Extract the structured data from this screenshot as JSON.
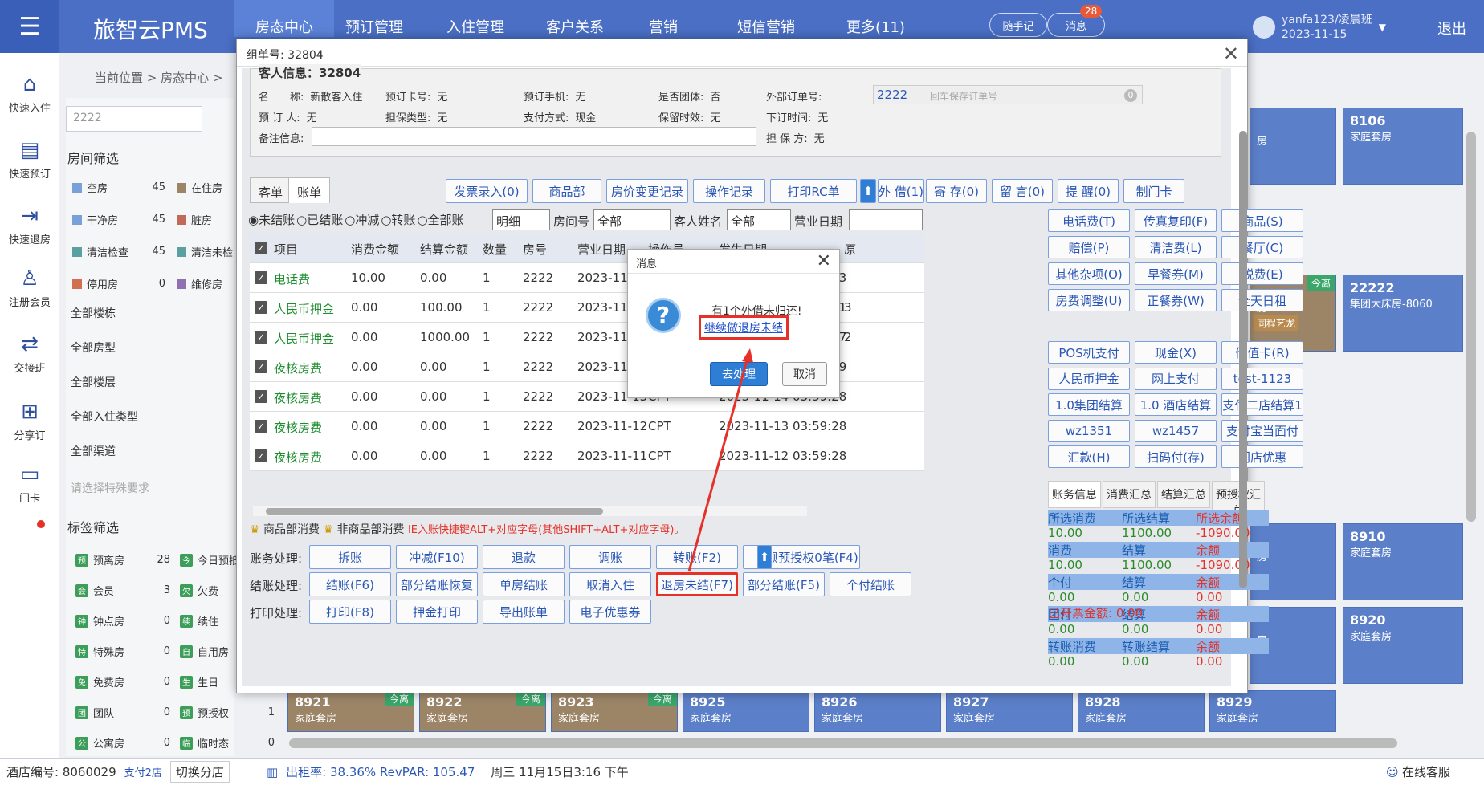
{
  "app": {
    "logo": "旅智云PMS",
    "logout": "退出"
  },
  "nav": [
    "房态中心",
    "预订管理",
    "入住管理",
    "客户关系",
    "营销",
    "短信营销",
    "更多(11)"
  ],
  "topActions": {
    "note": "随手记",
    "message": "消息",
    "messageCount": "28"
  },
  "user": {
    "name": "yanfa123/凌晨班",
    "date": "2023-11-15"
  },
  "leftNav": [
    "快速入住",
    "快速预订",
    "快速退房",
    "注册会员",
    "交接班",
    "分享订",
    "门卡"
  ],
  "breadcrumb": "当前位置 > 房态中心 >",
  "filter": {
    "searchValue": "2222",
    "title": "房间筛选",
    "status": [
      {
        "label": "空房",
        "count": "45",
        "color": "#7aa0d8"
      },
      {
        "label": "在住房",
        "count": "",
        "color": "#9c8567"
      },
      {
        "label": "干净房",
        "count": "45",
        "color": "#7aa0d8"
      },
      {
        "label": "脏房",
        "count": "",
        "color": "#c06a5a"
      },
      {
        "label": "清洁检查",
        "count": "45",
        "color": "#5aa0a0"
      },
      {
        "label": "清洁未检",
        "count": "",
        "color": "#5aa0a0"
      },
      {
        "label": "停用房",
        "count": "0",
        "color": "#d07050"
      },
      {
        "label": "维修房",
        "count": "",
        "color": "#9070b0"
      }
    ],
    "sections": [
      "全部楼栋",
      "全部房型",
      "全部楼层",
      "全部入住类型",
      "全部渠道"
    ],
    "specialPlaceholder": "请选择特殊要求",
    "tagTitle": "标签筛选",
    "tags": [
      {
        "label": "预离房",
        "count": "28"
      },
      {
        "label": "今日预抵",
        "count": ""
      },
      {
        "label": "会员",
        "count": "3"
      },
      {
        "label": "欠费",
        "count": ""
      },
      {
        "label": "钟点房",
        "count": "0"
      },
      {
        "label": "续住",
        "count": ""
      },
      {
        "label": "特殊房",
        "count": "0"
      },
      {
        "label": "自用房",
        "count": ""
      },
      {
        "label": "免费房",
        "count": "0"
      },
      {
        "label": "生日",
        "count": ""
      },
      {
        "label": "团队",
        "count": "0"
      },
      {
        "label": "预授权",
        "count": "1"
      },
      {
        "label": "公寓房",
        "count": "0"
      },
      {
        "label": "临时态",
        "count": "0"
      }
    ]
  },
  "rooms": {
    "right": [
      {
        "no": "8106",
        "type": "家庭套房",
        "today": ""
      },
      {
        "no": "22222",
        "type": "集团大床房-8060",
        "today": ""
      },
      {
        "no": "8910",
        "type": "家庭套房",
        "today": ""
      },
      {
        "no": "8920",
        "type": "家庭套房",
        "today": ""
      }
    ],
    "partialText": "房",
    "partialToday": "今离",
    "partialTag": "同程艺龙",
    "bottom": [
      {
        "no": "8921",
        "type": "家庭套房",
        "today": "今离"
      },
      {
        "no": "8922",
        "type": "家庭套房",
        "today": "今离"
      },
      {
        "no": "8923",
        "type": "家庭套房",
        "today": "今离"
      },
      {
        "no": "8925",
        "type": "家庭套房",
        "today": ""
      },
      {
        "no": "8926",
        "type": "家庭套房",
        "today": ""
      },
      {
        "no": "8927",
        "type": "家庭套房",
        "today": ""
      },
      {
        "no": "8928",
        "type": "家庭套房",
        "today": ""
      },
      {
        "no": "8929",
        "type": "家庭套房",
        "today": ""
      }
    ]
  },
  "status": {
    "hotelLabel": "酒店编号: 8060029",
    "branch": "支付2店",
    "switch": "切换分店",
    "rate": "出租率: 38.36% RevPAR: 105.47",
    "time": "周三 11月15日3:16 下午",
    "service": "在线客服"
  },
  "dialog": {
    "title": "组单号: 32804",
    "guestHeader": "客人信息：32804",
    "fields": [
      {
        "label": "名　　称:",
        "value": "新散客入住"
      },
      {
        "label": "预订卡号:",
        "value": "无"
      },
      {
        "label": "预订手机:",
        "value": "无"
      },
      {
        "label": "是否团体:",
        "value": "否"
      },
      {
        "label": "外部订单号:",
        "value": ""
      },
      {
        "label": "预 订 人:",
        "value": "无"
      },
      {
        "label": "担保类型:",
        "value": "无"
      },
      {
        "label": "支付方式:",
        "value": "现金"
      },
      {
        "label": "保留时效:",
        "value": "无"
      },
      {
        "label": "下订时间:",
        "value": "无"
      },
      {
        "label": "备注信息:",
        "value": ""
      },
      {
        "label": "担 保 方:",
        "value": "无"
      }
    ],
    "externalOrder": "2222",
    "externalPlaceholder": "回车保存订单号",
    "tabs": [
      "客单",
      "账单"
    ],
    "topButtons": [
      "发票录入(0)",
      "商品部",
      "房价变更记录",
      "操作记录",
      "打印RC单",
      "外 借(1)",
      "寄 存(0)",
      "留 言(0)",
      "提 醒(0)",
      "制门卡"
    ],
    "radios": [
      "未结账",
      "已结账",
      "冲减",
      "转账",
      "全部账"
    ],
    "detail": "明细",
    "roomLabel": "房间号",
    "roomValue": "全部",
    "guestLabel": "客人姓名",
    "guestValue": "全部",
    "dateLabel": "营业日期",
    "columns": [
      "项目",
      "消费金额",
      "结算金额",
      "数量",
      "房号",
      "营业日期",
      "操作员",
      "发生日期",
      "原"
    ],
    "rows": [
      {
        "item": "电话费",
        "consume": "10.00",
        "settle": "0.00",
        "qty": "1",
        "room": "2222",
        "bdate": "2023-11-15",
        "op": "CPT",
        "odate": "2023-11-15 16:57:13",
        "extra": ""
      },
      {
        "item": "人民币押金",
        "consume": "0.00",
        "settle": "100.00",
        "qty": "1",
        "room": "2222",
        "bdate": "2023-11-15",
        "op": "CPT",
        "odate": "2023-11-15 15:32:51",
        "extra": "3"
      },
      {
        "item": "人民币押金",
        "consume": "0.00",
        "settle": "1000.00",
        "qty": "1",
        "room": "2222",
        "bdate": "2023-11-15",
        "op": "CPT",
        "odate": "2023-11-15 15:31:27",
        "extra": "2"
      },
      {
        "item": "夜核房费",
        "consume": "0.00",
        "settle": "0.00",
        "qty": "1",
        "room": "2222",
        "bdate": "2023-11-14",
        "op": "CPT",
        "odate": "2023-11-15 03:59:29",
        "extra": ""
      },
      {
        "item": "夜核房费",
        "consume": "0.00",
        "settle": "0.00",
        "qty": "1",
        "room": "2222",
        "bdate": "2023-11-13",
        "op": "CPT",
        "odate": "2023-11-14 03:59:28",
        "extra": ""
      },
      {
        "item": "夜核房费",
        "consume": "0.00",
        "settle": "0.00",
        "qty": "1",
        "room": "2222",
        "bdate": "2023-11-12",
        "op": "CPT",
        "odate": "2023-11-13 03:59:28",
        "extra": ""
      },
      {
        "item": "夜核房费",
        "consume": "0.00",
        "settle": "0.00",
        "qty": "1",
        "room": "2222",
        "bdate": "2023-11-11",
        "op": "CPT",
        "odate": "2023-11-12 03:59:28",
        "extra": ""
      }
    ],
    "rightButtonsA": [
      "电话费(T)",
      "传真复印(F)",
      "商品(S)",
      "赔偿(P)",
      "清洁费(L)",
      "餐厅(C)",
      "其他杂项(O)",
      "早餐券(M)",
      "税费(E)",
      "房费调整(U)",
      "正餐券(W)",
      "全天日租"
    ],
    "rightButtonsB": [
      "POS机支付",
      "现金(X)",
      "储值卡(R)",
      "人民币押金",
      "网上支付",
      "test-1123",
      "1.0集团结算",
      "1.0 酒店结算",
      "支付二店结算1",
      "wz1351",
      "wz1457",
      "支付宝当面付",
      "汇款(H)",
      "扫码付(存)",
      "门店优惠"
    ],
    "summaryTabs": [
      "账务信息",
      "消费汇总",
      "结算汇总",
      "预授权汇总"
    ],
    "summary": [
      {
        "a": "所选消费",
        "b": "所选结算",
        "c": "所选余额",
        "hd": true
      },
      {
        "a": "10.00",
        "b": "1100.00",
        "c": "-1090.00",
        "hd": false
      },
      {
        "a": "消费",
        "b": "结算",
        "c": "余额",
        "hd": true
      },
      {
        "a": "10.00",
        "b": "1100.00",
        "c": "-1090.00",
        "hd": false
      },
      {
        "a": "个付",
        "b": "结算",
        "c": "余额",
        "hd": true
      },
      {
        "a": "0.00",
        "b": "0.00",
        "c": "0.00",
        "hd": false
      },
      {
        "a": "团付",
        "b": "结算",
        "c": "余额",
        "hd": true
      },
      {
        "a": "0.00",
        "b": "0.00",
        "c": "0.00",
        "hd": false
      },
      {
        "a": "转账消费",
        "b": "转账结算",
        "c": "余额",
        "hd": true
      },
      {
        "a": "0.00",
        "b": "0.00",
        "c": "0.00",
        "hd": false
      }
    ],
    "invoice": "已开票金额: 0.00",
    "legend": "商品部消费",
    "legend2": "非商品部消费",
    "hint": "IE入账快捷键ALT+对应字母(其他SHIFT+ALT+对应字母)。",
    "accountLabel": "账务处理:",
    "accountButtons": [
      "拆账",
      "冲减(F10)",
      "退款",
      "调账",
      "转账(F2)",
      "入账(F3)",
      "预授权0笔(F4)"
    ],
    "settleLabel": "结账处理:",
    "settleButtons": [
      "结账(F6)",
      "部分结账恢复",
      "单房结账",
      "取消入住",
      "退房未结(F7)",
      "部分结账(F5)",
      "个付结账"
    ],
    "printLabel": "打印处理:",
    "printButtons": [
      "打印(F8)",
      "押金打印",
      "导出账单",
      "电子优惠券"
    ]
  },
  "msg": {
    "title": "消息",
    "text": "有1个外借未归还!",
    "link": "继续做退房未结",
    "ok": "去处理",
    "cancel": "取消"
  },
  "colors": {
    "topbar": "#4a6fc4",
    "room": "#5b7fc8",
    "roomBrown": "#9c8567",
    "highlight": "#e53128"
  }
}
